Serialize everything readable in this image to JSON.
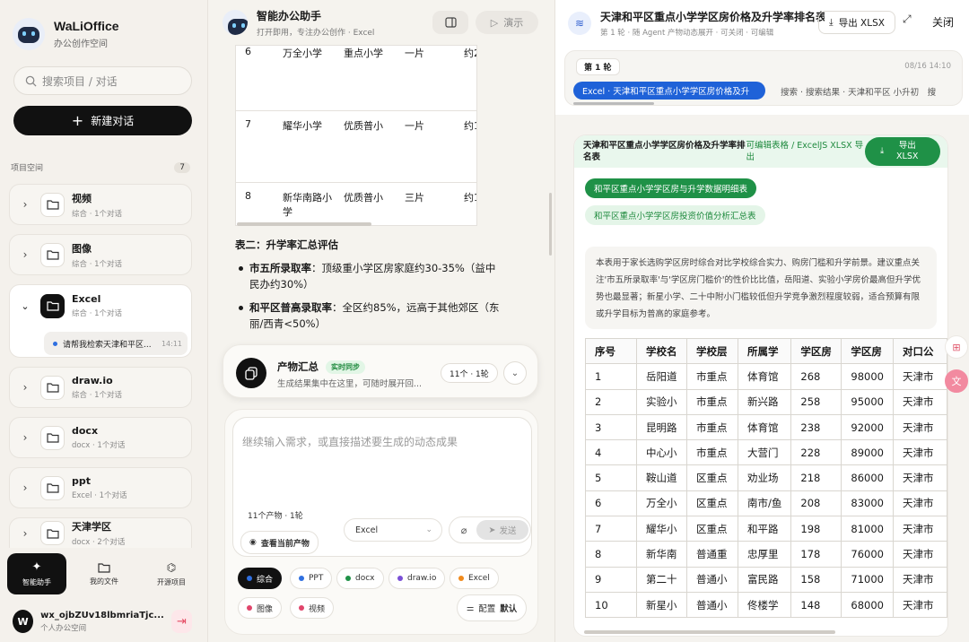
{
  "sidebar": {
    "brand_title": "WaLiOffice",
    "brand_sub": "办公创作空间",
    "search_placeholder": "搜索项目 / 对话",
    "new_chat": "新建对话",
    "section_label": "项目空间",
    "section_count": "7",
    "projects": [
      {
        "name": "视频",
        "meta": "综合 · 1个对话"
      },
      {
        "name": "图像",
        "meta": "综合 · 1个对话"
      },
      {
        "name": "Excel",
        "meta": "综合 · 1个对话"
      },
      {
        "name": "draw.io",
        "meta": "综合 · 1个对话"
      },
      {
        "name": "docx",
        "meta": "docx · 1个对话"
      },
      {
        "name": "ppt",
        "meta": "Excel · 1个对话"
      },
      {
        "name": "天津学区",
        "meta": "docx · 2个对话"
      }
    ],
    "sub_item": {
      "label": "请帮我检索天津和平区...",
      "time": "14:11"
    },
    "nav": [
      {
        "label": "智能助手"
      },
      {
        "label": "我的文件"
      },
      {
        "label": "开源项目"
      }
    ],
    "user": {
      "initial": "W",
      "name": "wx_ojbZUv18lbmriaTjc...",
      "sub": "个人办公空间"
    }
  },
  "middle": {
    "title": "智能办公助手",
    "subtitle": "打开即用，专注办公创作 · Excel",
    "demo_label": "演示",
    "table_rows": [
      {
        "no": "6",
        "name": "万全小学",
        "level": "重点小学",
        "zone": "一片",
        "price": "约2"
      },
      {
        "no": "7",
        "name": "耀华小学",
        "level": "优质普小",
        "zone": "一片",
        "price": "约1"
      },
      {
        "no": "8",
        "name": "新华南路小学",
        "level": "优质普小",
        "zone": "三片",
        "price": "约1"
      }
    ],
    "section_title": "表二：升学率汇总评估",
    "bullets": [
      {
        "strong": "市五所录取率",
        "text": "：顶级重小学区房家庭约30-35%（益中民办约30%）"
      },
      {
        "strong": "和平区普高录取率",
        "text": "：全区约85%，远高于其他郊区（东丽/西青<50%）"
      }
    ],
    "product": {
      "title": "产物汇总",
      "badge": "实时同步",
      "desc": "生成结果集中在这里，可随时展开回...",
      "count": "11个 · 1轮"
    },
    "composer": {
      "placeholder": "继续输入需求，或直接描述要生成的动态成果",
      "count_chip": "11个产物 · 1轮",
      "view_label": "查看当前产物",
      "select_value": "Excel",
      "send_label": "发送",
      "tags": [
        {
          "label": "综合",
          "color": "#2f6fe0"
        },
        {
          "label": "PPT",
          "color": "#2f6fe0"
        },
        {
          "label": "docx",
          "color": "#1f9147"
        },
        {
          "label": "draw.io",
          "color": "#7a4fd6"
        },
        {
          "label": "Excel",
          "color": "#f08a1c"
        },
        {
          "label": "图像",
          "color": "#e0456b"
        },
        {
          "label": "视频",
          "color": "#e0456b"
        }
      ],
      "config_label": "配置",
      "config_value": "默认"
    }
  },
  "right": {
    "title": "天津和平区重点小学学区房价格及升学率排名表",
    "subtitle": "第 1 轮 · 随 Agent 产物动态展开 · 可关闭 · 可编辑",
    "export_label": "导出 XLSX",
    "close_label": "关闭",
    "turn_label": "第 1 轮",
    "turn_date": "08/16 14:10",
    "artifact_active": "Excel · 天津和平区重点小学学区房价格及升",
    "artifact_other": "搜索 · 搜索结果 · 天津和平区 小升初　搜",
    "card_title": "天津和平区重点小学学区房价格及升学率排名表",
    "card_sub": "可编辑表格 / ExcelJS XLSX 导出",
    "card_export": "导出 XLSX",
    "sheet_tabs": [
      "和平区重点小学学区房与升学数据明细表",
      "和平区重点小学学区房投资价值分析汇总表"
    ],
    "description": "本表用于家长选购学区房时综合对比学校综合实力、购房门槛和升学前景。建议重点关注'市五所录取率'与'学区房门槛价'的性价比比值，岳阳道、实验小学房价最高但升学优势也最显著；新星小学、二十中附小门槛较低但升学竞争激烈程度较弱，适合预算有限或升学目标为普高的家庭参考。",
    "table": {
      "headers": [
        "序号",
        "学校名",
        "学校层",
        "所属学",
        "学区房",
        "学区房",
        "对口公"
      ],
      "rows": [
        [
          "1",
          "岳阳道",
          "市重点",
          "体育馆",
          "268",
          "98000",
          "天津市"
        ],
        [
          "2",
          "实验小",
          "市重点",
          "新兴路",
          "258",
          "95000",
          "天津市"
        ],
        [
          "3",
          "昆明路",
          "市重点",
          "体育馆",
          "238",
          "92000",
          "天津市"
        ],
        [
          "4",
          "中心小",
          "市重点",
          "大营门",
          "228",
          "89000",
          "天津市"
        ],
        [
          "5",
          "鞍山道",
          "区重点",
          "劝业场",
          "218",
          "86000",
          "天津市"
        ],
        [
          "6",
          "万全小",
          "区重点",
          "南市/鱼",
          "208",
          "83000",
          "天津市"
        ],
        [
          "7",
          "耀华小",
          "区重点",
          "和平路",
          "198",
          "81000",
          "天津市"
        ],
        [
          "8",
          "新华南",
          "普通重",
          "忠厚里",
          "178",
          "76000",
          "天津市"
        ],
        [
          "9",
          "第二十",
          "普通小",
          "富民路",
          "158",
          "71000",
          "天津市"
        ],
        [
          "10",
          "新星小",
          "普通小",
          "佟楼学",
          "148",
          "68000",
          "天津市"
        ]
      ]
    }
  }
}
